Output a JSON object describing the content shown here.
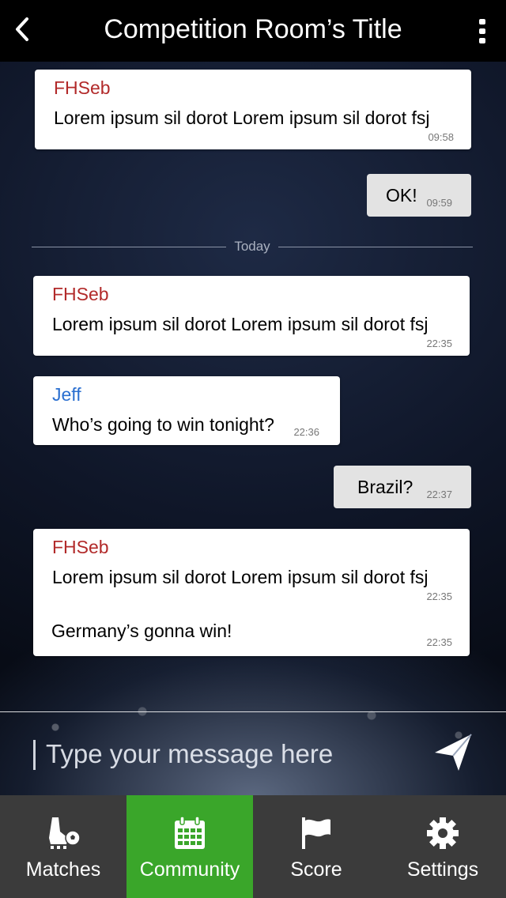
{
  "header": {
    "title": "Competition Room’s Title",
    "back_icon": "chevron-left-icon",
    "more_icon": "more-vertical-icon"
  },
  "messages": [
    {
      "author": "FHSeb",
      "text": "Lorem ipsum sil dorot Lorem ipsum sil dorot fsj",
      "time": "09:58"
    },
    {
      "text": "OK!",
      "time": "09:59"
    },
    {
      "author": "FHSeb",
      "text": "Lorem ipsum sil dorot Lorem ipsum sil dorot fsj",
      "time": "22:35"
    },
    {
      "author": "Jeff",
      "text": "Who’s going to win tonight?",
      "time": "22:36"
    },
    {
      "text": "Brazil?",
      "time": "22:37"
    },
    {
      "author": "FHSeb",
      "lines": [
        {
          "text": "Lorem ipsum sil dorot Lorem ipsum sil dorot fsj",
          "time": "22:35"
        },
        {
          "text": "Germany’s gonna win!",
          "time": "22:35"
        }
      ]
    }
  ],
  "divider_label": "Today",
  "composer": {
    "placeholder": "Type your message here",
    "send_icon": "send-icon"
  },
  "tabs": [
    {
      "label": "Matches",
      "icon": "soccer-boot-icon",
      "active": false
    },
    {
      "label": "Community",
      "icon": "calendar-icon",
      "active": true
    },
    {
      "label": "Score",
      "icon": "flag-icon",
      "active": false
    },
    {
      "label": "Settings",
      "icon": "gear-icon",
      "active": false
    }
  ],
  "colors": {
    "header": "#000000",
    "active_tab": "#3aa62a",
    "tabbar": "#3b3b3b",
    "author_red": "#b22a2a",
    "author_blue": "#2a6fd0",
    "own_bubble": "#e3e3e3"
  }
}
